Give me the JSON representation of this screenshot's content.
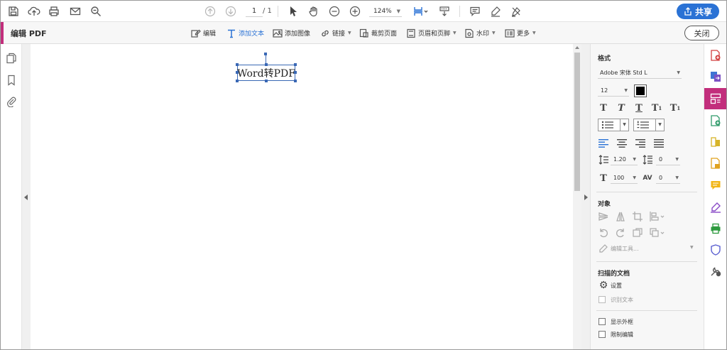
{
  "toolbar": {
    "page_current": "1",
    "page_total": "/ 1",
    "zoom": "124%",
    "share_label": "共享"
  },
  "editbar": {
    "title": "编辑 PDF",
    "items": [
      {
        "label": "编辑",
        "icon": "edit-icon"
      },
      {
        "label": "添加文本",
        "icon": "add-text-icon"
      },
      {
        "label": "添加图像",
        "icon": "add-image-icon"
      },
      {
        "label": "链接",
        "icon": "link-icon"
      },
      {
        "label": "裁剪页面",
        "icon": "crop-page-icon"
      },
      {
        "label": "页眉和页脚",
        "icon": "header-footer-icon"
      },
      {
        "label": "水印",
        "icon": "watermark-icon"
      },
      {
        "label": "更多",
        "icon": "more-icon"
      }
    ],
    "close_label": "关闭"
  },
  "document": {
    "textbox_text": "Word转PDF"
  },
  "format_panel": {
    "section_format": "格式",
    "font_family": "Adobe 宋体 Std L",
    "font_size": "12",
    "text_color": "#000000",
    "line_spacing": "1.20",
    "paragraph_spacing": "0",
    "horizontal_scale": "100",
    "char_spacing": "0",
    "section_object": "对象",
    "edit_tools_label": "编辑工具...",
    "section_scanned": "扫描的文档",
    "settings_label": "设置",
    "recognize_text_label": "识别文本",
    "show_bounding_label": "显示外框",
    "restrict_edit_label": "限制编辑"
  },
  "colors": {
    "accent": "#c22e7c",
    "primary_button": "#2a72d5",
    "selection": "#3a68b5"
  }
}
